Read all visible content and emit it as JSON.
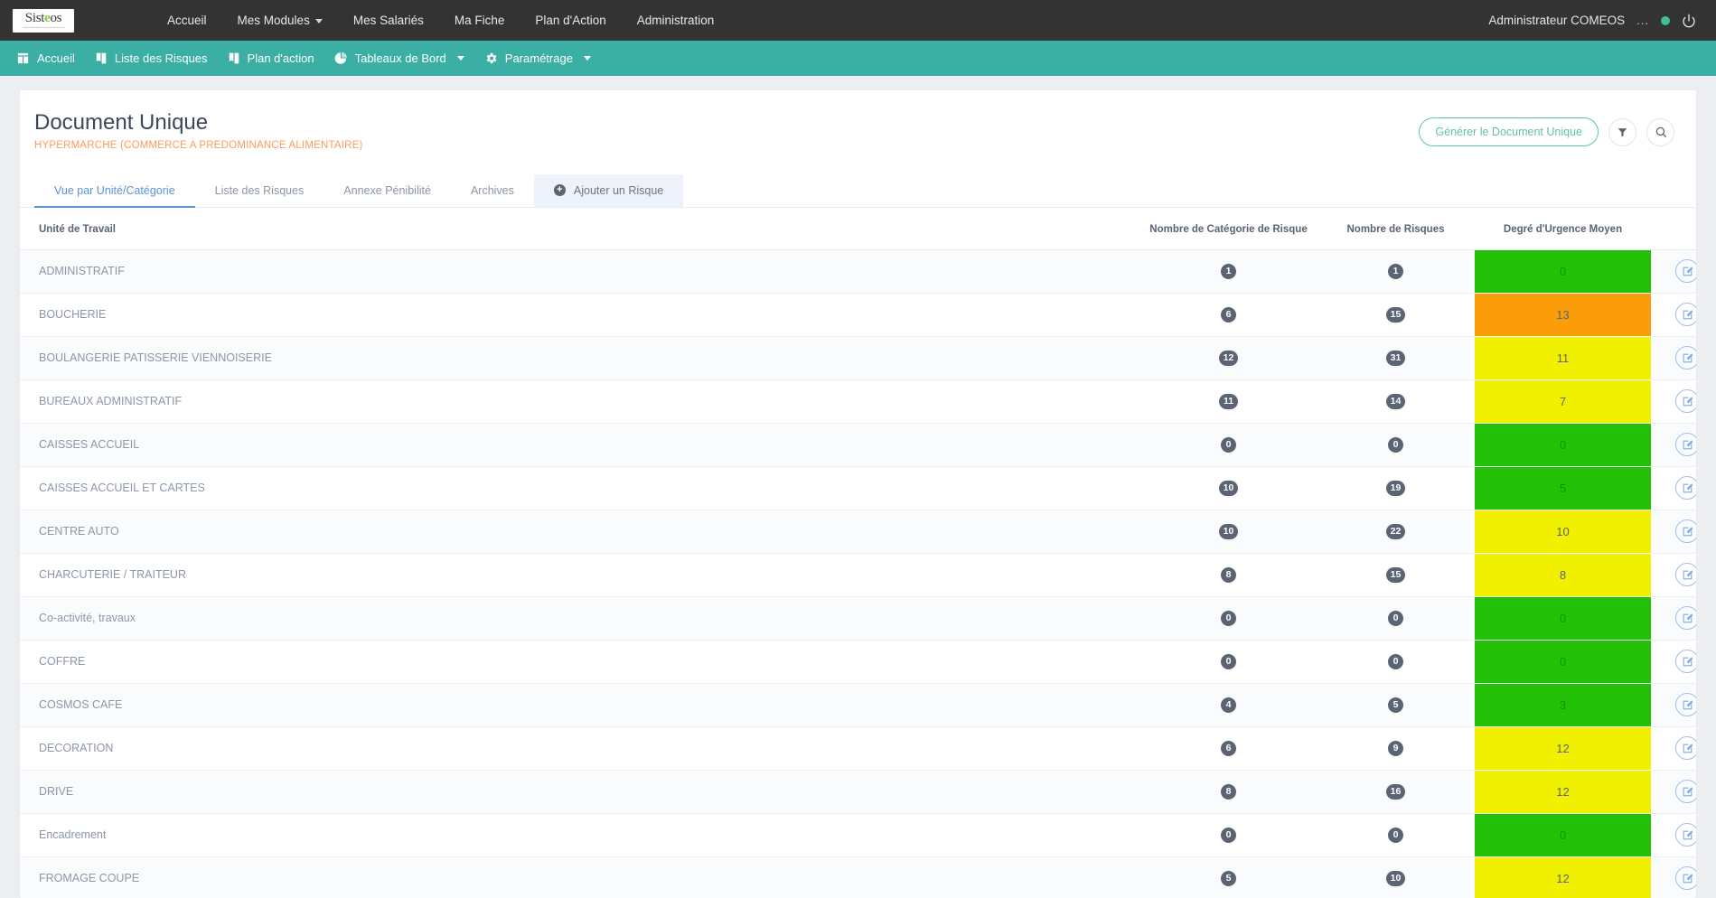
{
  "topbar": {
    "logo_text": "Sist",
    "logo_apple": "e",
    "logo_text2": "os",
    "logo_tagline": "solutions informatiques santé et sécurité au travail",
    "nav": [
      {
        "label": "Accueil",
        "caret": false
      },
      {
        "label": "Mes Modules",
        "caret": true
      },
      {
        "label": "Mes Salariés",
        "caret": false
      },
      {
        "label": "Ma Fiche",
        "caret": false
      },
      {
        "label": "Plan d'Action",
        "caret": false
      },
      {
        "label": "Administration",
        "caret": false
      }
    ],
    "user_name": "Administrateur COMEOS",
    "user_dots": "...",
    "status_color": "#3fbf8f",
    "power_icon": "power-icon"
  },
  "subnav": {
    "items": [
      {
        "label": "Accueil",
        "icon": "dashboard-icon",
        "caret": false
      },
      {
        "label": "Liste des Risques",
        "icon": "book-icon",
        "caret": false
      },
      {
        "label": "Plan d'action",
        "icon": "book-icon",
        "caret": false
      },
      {
        "label": "Tableaux de Bord",
        "icon": "pie-chart-icon",
        "caret": true
      },
      {
        "label": "Paramétrage",
        "icon": "gear-icon",
        "caret": true
      }
    ],
    "background": "#3bafa4"
  },
  "header": {
    "title": "Document Unique",
    "subtitle": "HYPERMARCHE (COMMERCE A PREDOMINANCE ALIMENTAIRE)",
    "subtitle_color": "#ff9a5c",
    "generate_button": "Générer le Document Unique",
    "filter_icon": "filter-icon",
    "search_icon": "search-icon"
  },
  "tabs": [
    {
      "label": "Vue par Unité/Catégorie",
      "active": true
    },
    {
      "label": "Liste des Risques",
      "active": false
    },
    {
      "label": "Annexe Pénibilité",
      "active": false
    },
    {
      "label": "Archives",
      "active": false
    },
    {
      "label": "Ajouter un Risque",
      "active": false,
      "add": true
    }
  ],
  "table": {
    "columns": [
      "Unité de Travail",
      "Nombre de Catégorie de Risque",
      "Nombre de Risques",
      "Degré d'Urgence Moyen",
      ""
    ],
    "colors": {
      "green": "#22c107",
      "yellow": "#f0f000",
      "orange": "#fb9d09"
    },
    "rows": [
      {
        "unit": "ADMINISTRATIF",
        "categories": "1",
        "risks": "1",
        "urgency": "0",
        "urgency_color": "green"
      },
      {
        "unit": "BOUCHERIE",
        "categories": "6",
        "risks": "15",
        "urgency": "13",
        "urgency_color": "orange"
      },
      {
        "unit": "BOULANGERIE PATISSERIE VIENNOISERIE",
        "categories": "12",
        "risks": "31",
        "urgency": "11",
        "urgency_color": "yellow"
      },
      {
        "unit": "BUREAUX ADMINISTRATIF",
        "categories": "11",
        "risks": "14",
        "urgency": "7",
        "urgency_color": "yellow"
      },
      {
        "unit": "CAISSES ACCUEIL",
        "categories": "0",
        "risks": "0",
        "urgency": "0",
        "urgency_color": "green"
      },
      {
        "unit": "CAISSES ACCUEIL ET CARTES",
        "categories": "10",
        "risks": "19",
        "urgency": "5",
        "urgency_color": "green"
      },
      {
        "unit": "CENTRE AUTO",
        "categories": "10",
        "risks": "22",
        "urgency": "10",
        "urgency_color": "yellow"
      },
      {
        "unit": "CHARCUTERIE / TRAITEUR",
        "categories": "8",
        "risks": "15",
        "urgency": "8",
        "urgency_color": "yellow"
      },
      {
        "unit": "Co-activité, travaux",
        "categories": "0",
        "risks": "0",
        "urgency": "0",
        "urgency_color": "green"
      },
      {
        "unit": "COFFRE",
        "categories": "0",
        "risks": "0",
        "urgency": "0",
        "urgency_color": "green"
      },
      {
        "unit": "COSMOS CAFE",
        "categories": "4",
        "risks": "5",
        "urgency": "3",
        "urgency_color": "green"
      },
      {
        "unit": "DECORATION",
        "categories": "6",
        "risks": "9",
        "urgency": "12",
        "urgency_color": "yellow"
      },
      {
        "unit": "DRIVE",
        "categories": "8",
        "risks": "16",
        "urgency": "12",
        "urgency_color": "yellow"
      },
      {
        "unit": "Encadrement",
        "categories": "0",
        "risks": "0",
        "urgency": "0",
        "urgency_color": "green"
      },
      {
        "unit": "FROMAGE COUPE",
        "categories": "5",
        "risks": "10",
        "urgency": "12",
        "urgency_color": "yellow"
      }
    ],
    "edit_icon": "edit-icon"
  }
}
